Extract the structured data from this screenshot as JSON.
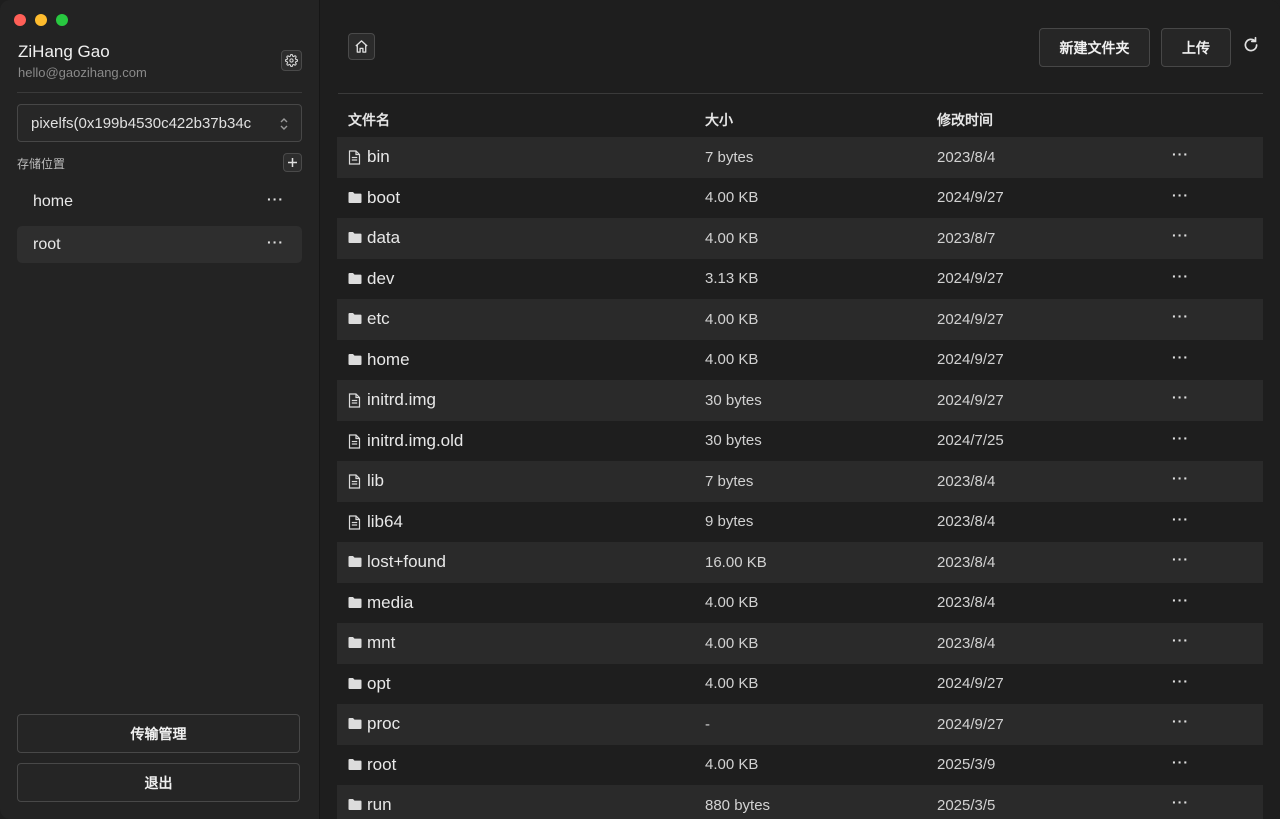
{
  "user": {
    "name": "ZiHang Gao",
    "email": "hello@gaozihang.com"
  },
  "storage_select": {
    "value": "pixelfs(0x199b4530c422b37b34c"
  },
  "storage": {
    "label": "存储位置",
    "items": [
      {
        "label": "home",
        "more": "···"
      },
      {
        "label": "root",
        "more": "···"
      }
    ]
  },
  "sidebar_buttons": {
    "transfer": "传输管理",
    "logout": "退出"
  },
  "toolbar": {
    "new_folder": "新建文件夹",
    "upload": "上传"
  },
  "table": {
    "headers": {
      "name": "文件名",
      "size": "大小",
      "modified": "修改时间"
    },
    "rows": [
      {
        "type": "file",
        "name": "bin",
        "size": "7 bytes",
        "modified": "2023/8/4",
        "more": "···"
      },
      {
        "type": "folder",
        "name": "boot",
        "size": "4.00 KB",
        "modified": "2024/9/27",
        "more": "···"
      },
      {
        "type": "folder",
        "name": "data",
        "size": "4.00 KB",
        "modified": "2023/8/7",
        "more": "···"
      },
      {
        "type": "folder",
        "name": "dev",
        "size": "3.13 KB",
        "modified": "2024/9/27",
        "more": "···"
      },
      {
        "type": "folder",
        "name": "etc",
        "size": "4.00 KB",
        "modified": "2024/9/27",
        "more": "···"
      },
      {
        "type": "folder",
        "name": "home",
        "size": "4.00 KB",
        "modified": "2024/9/27",
        "more": "···"
      },
      {
        "type": "file",
        "name": "initrd.img",
        "size": "30 bytes",
        "modified": "2024/9/27",
        "more": "···"
      },
      {
        "type": "file",
        "name": "initrd.img.old",
        "size": "30 bytes",
        "modified": "2024/7/25",
        "more": "···"
      },
      {
        "type": "file",
        "name": "lib",
        "size": "7 bytes",
        "modified": "2023/8/4",
        "more": "···"
      },
      {
        "type": "file",
        "name": "lib64",
        "size": "9 bytes",
        "modified": "2023/8/4",
        "more": "···"
      },
      {
        "type": "folder",
        "name": "lost+found",
        "size": "16.00 KB",
        "modified": "2023/8/4",
        "more": "···"
      },
      {
        "type": "folder",
        "name": "media",
        "size": "4.00 KB",
        "modified": "2023/8/4",
        "more": "···"
      },
      {
        "type": "folder",
        "name": "mnt",
        "size": "4.00 KB",
        "modified": "2023/8/4",
        "more": "···"
      },
      {
        "type": "folder",
        "name": "opt",
        "size": "4.00 KB",
        "modified": "2024/9/27",
        "more": "···"
      },
      {
        "type": "folder",
        "name": "proc",
        "size": "-",
        "modified": "2024/9/27",
        "more": "···"
      },
      {
        "type": "folder",
        "name": "root",
        "size": "4.00 KB",
        "modified": "2025/3/9",
        "more": "···"
      },
      {
        "type": "folder",
        "name": "run",
        "size": "880 bytes",
        "modified": "2025/3/5",
        "more": "···"
      }
    ]
  }
}
